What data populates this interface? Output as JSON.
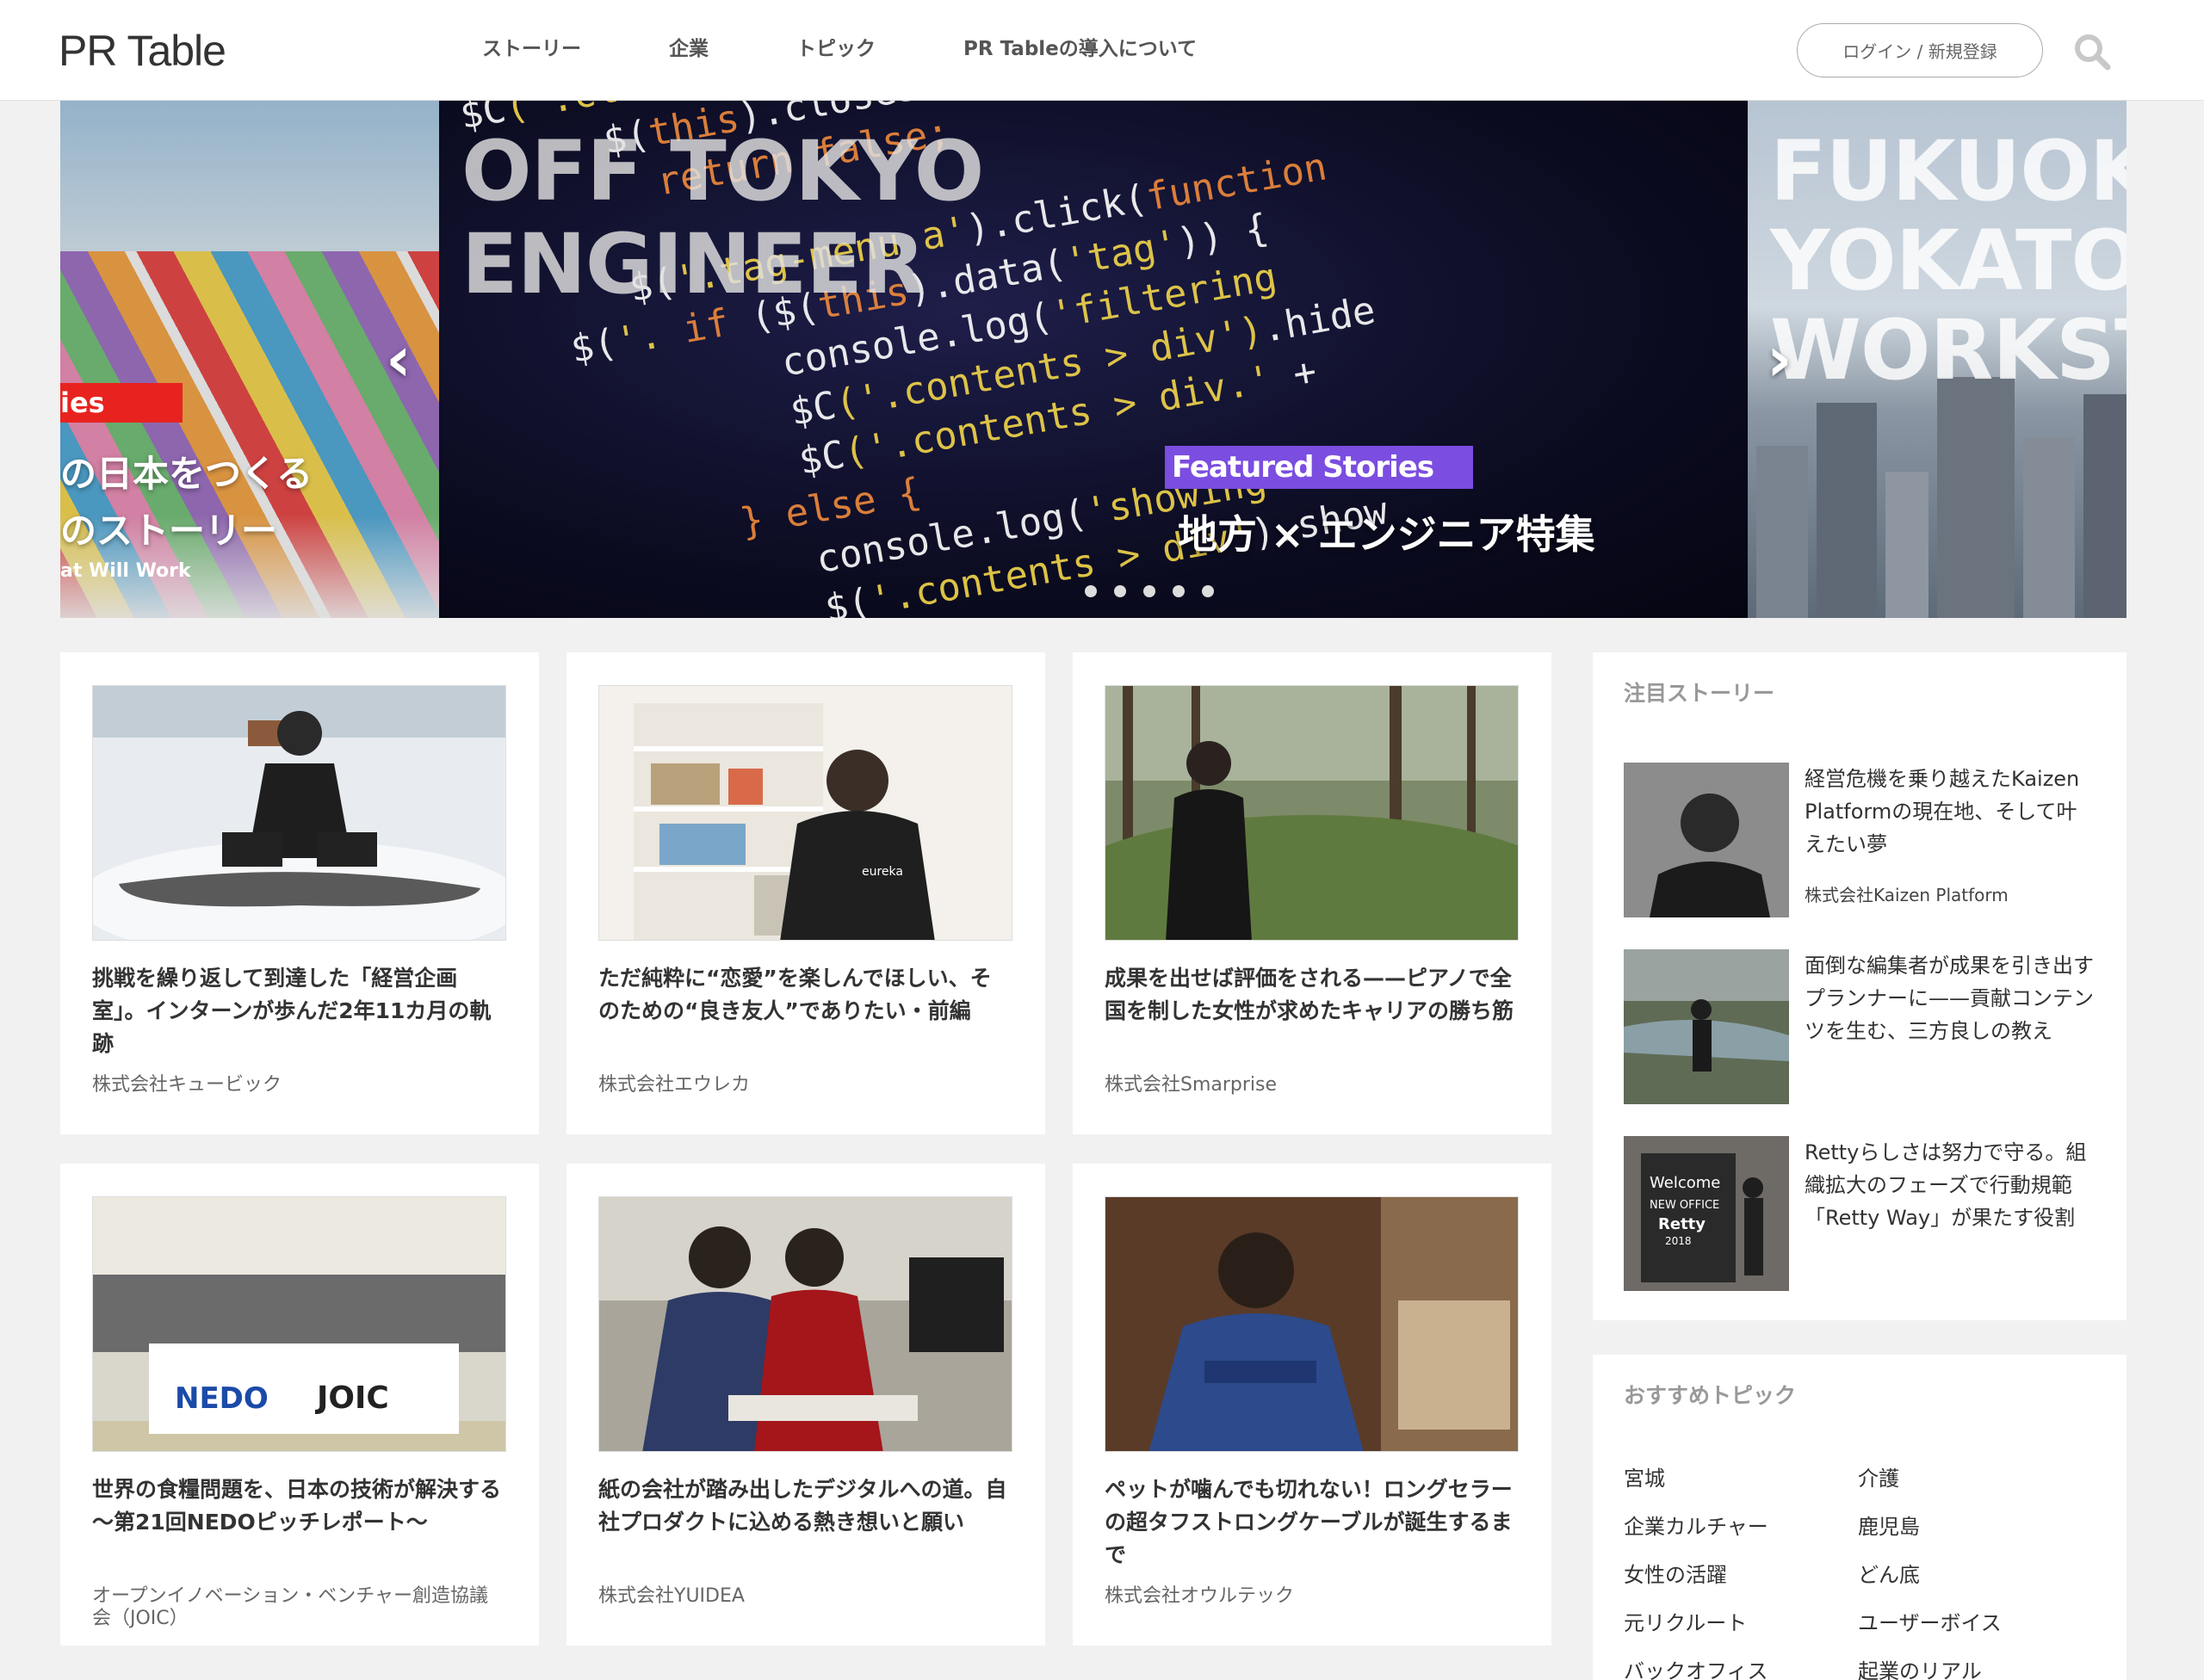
{
  "header": {
    "logo": "PR Table",
    "nav": [
      "ストーリー",
      "企業",
      "トピック",
      "PR Tableの導入について"
    ],
    "login": "ログイン / 新規登録",
    "search_icon": "search-icon"
  },
  "hero": {
    "left": {
      "tag": "ies",
      "line1": "の日本をつくる",
      "line2": "のストーリー",
      "sub": "at Will Work"
    },
    "main": {
      "title_line1": "OFF TOKYO",
      "title_line2": "ENGINEER",
      "tag": "Featured Stories",
      "caption": "地方 × エンジニア特集"
    },
    "right": {
      "title_line1": "FUKUOKA",
      "title_line2": "YOKATOI",
      "title_line3": "WORKST"
    },
    "prev_icon": "chevron-left-icon",
    "next_icon": "chevron-right-icon",
    "dot_count": 5,
    "accent_left": "#e8231f",
    "accent_featured": "#7b4de0"
  },
  "cards": [
    {
      "title": "挑戦を繰り返して到達した「経営企画室」。インターンが歩んだ2年11カ月の軌跡",
      "company": "株式会社キュービック"
    },
    {
      "title": "ただ純粋に“恋愛”を楽しんでほしい、そのための“良き友人”でありたい・前編",
      "company": "株式会社エウレカ"
    },
    {
      "title": "成果を出せば評価をされる——ピアノで全国を制した女性が求めたキャリアの勝ち筋",
      "company": "株式会社Smarprise"
    },
    {
      "title": "世界の食糧問題を、日本の技術が解決する 〜第21回NEDOピッチレポート〜",
      "company": "オープンイノベーション・ベンチャー創造協議会（JOIC）"
    },
    {
      "title": "紙の会社が踏み出したデジタルへの道。自社プロダクトに込める熱き想いと願い",
      "company": "株式会社YUIDEA"
    },
    {
      "title": "ペットが噛んでも切れない！ロングセラーの超タフストロングケーブルが誕生するまで",
      "company": "株式会社オウルテック"
    }
  ],
  "banner_texts": {
    "nedo": "NEDO",
    "joic": "JOIC",
    "hoodie": "eureka",
    "retty_welcome": "Welcome",
    "retty_new_office": "NEW OFFICE",
    "retty": "Retty",
    "retty_year": "2018"
  },
  "sidebar": {
    "featured_heading": "注目ストーリー",
    "featured": [
      {
        "title": "経営危機を乗り越えたKaizen Platformの現在地、そして叶えたい夢",
        "company": "株式会社Kaizen Platform"
      },
      {
        "title": "面倒な編集者が成果を引き出すプランナーに——貢献コンテンツを生む、三方良しの教え",
        "company": ""
      },
      {
        "title": "Rettyらしさは努力で守る。組織拡大のフェーズで行動規範「Retty Way」が果たす役割",
        "company": ""
      }
    ],
    "topics_heading": "おすすめトピック",
    "topics": [
      "宮城",
      "介護",
      "企業カルチャー",
      "鹿児島",
      "女性の活躍",
      "どん底",
      "元リクルート",
      "ユーザーボイス",
      "バックオフィス",
      "起業のリアル"
    ]
  }
}
